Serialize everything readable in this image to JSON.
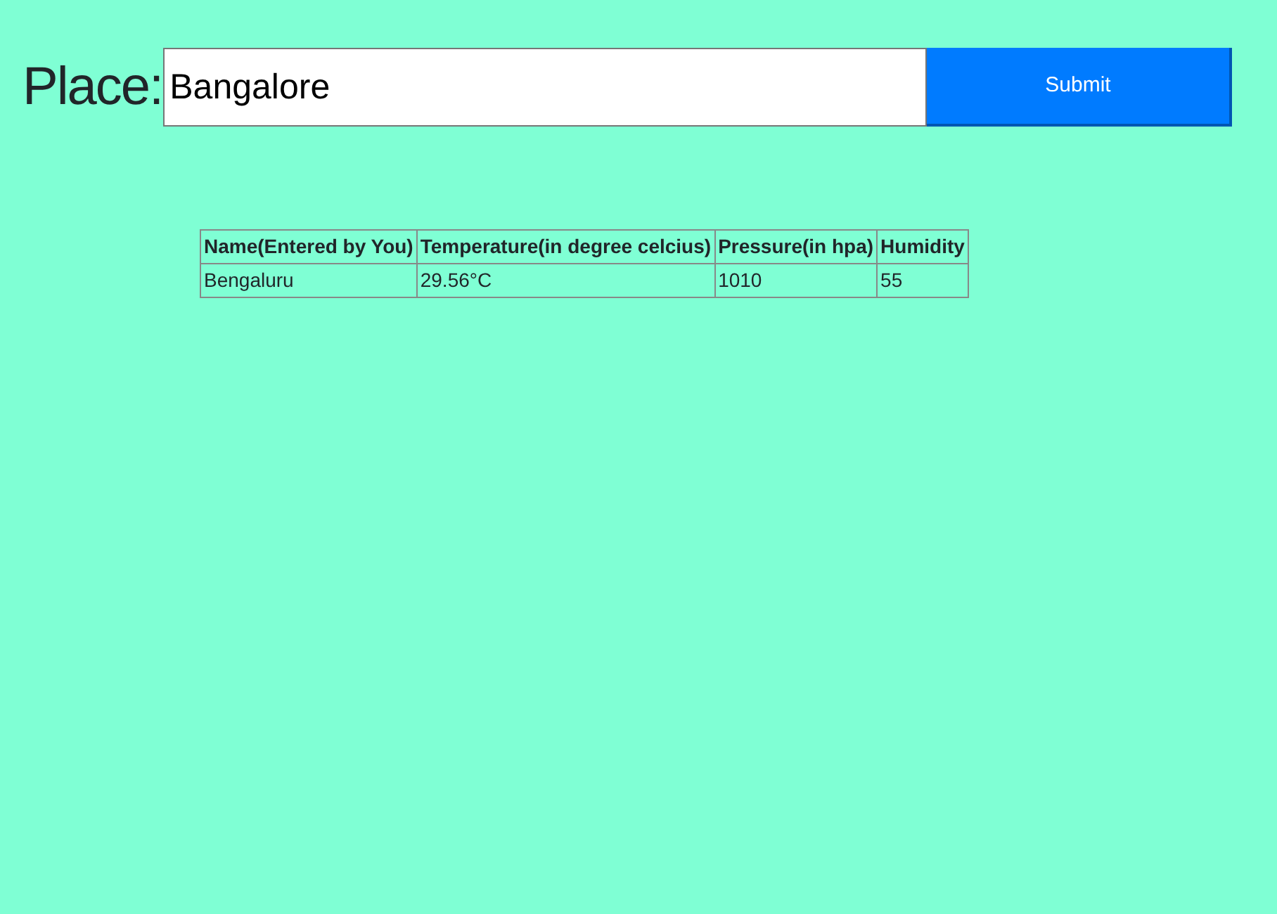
{
  "form": {
    "label": "Place:",
    "value": "Bangalore",
    "button": "Submit"
  },
  "table": {
    "columns": [
      "Name(Entered by You)",
      "Temperature(in degree celcius)",
      "Pressure(in hpa)",
      "Humidity"
    ],
    "rows": [
      [
        "Bengaluru",
        "29.56°C",
        "1010",
        "55"
      ]
    ]
  }
}
